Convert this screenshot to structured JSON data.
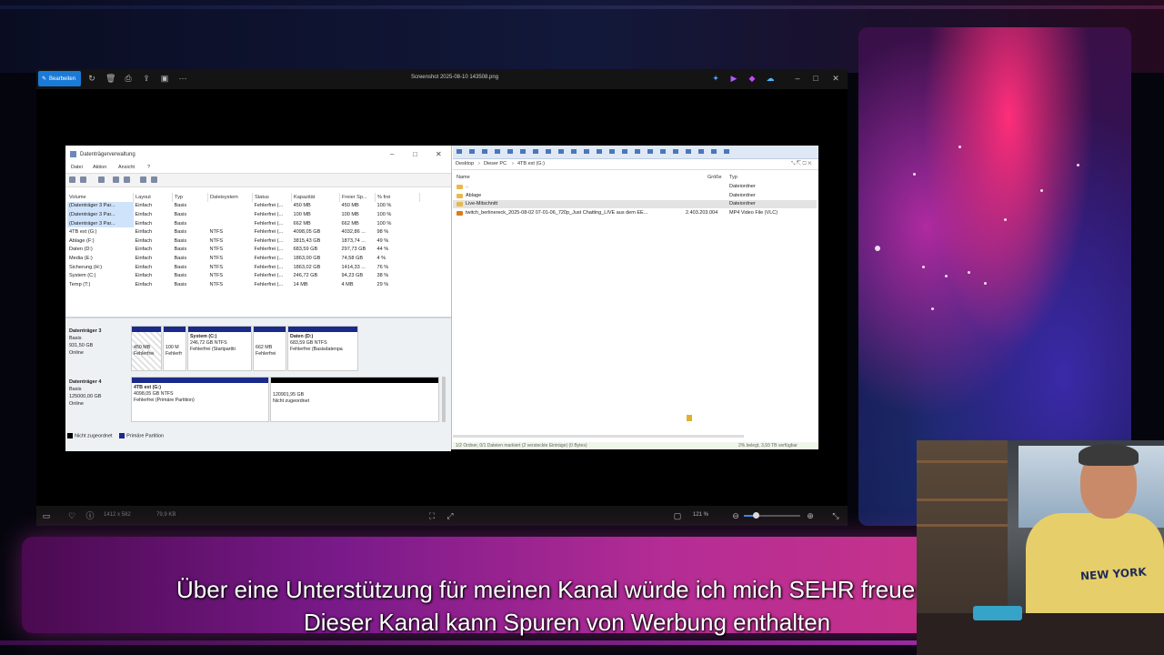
{
  "viewer": {
    "edit_label": "Bearbeiten",
    "title": "Screenshot 2025-08-10 143508.png",
    "zoom": "121 %",
    "info_dims": "1412 x 582",
    "info_size": "79,9 KB"
  },
  "disk_mgmt": {
    "title": "Datenträgerverwaltung",
    "menu": [
      "Datei",
      "Aktion",
      "Ansicht",
      "?"
    ],
    "columns": [
      "Volume",
      "Layout",
      "Typ",
      "Dateisystem",
      "Status",
      "Kapazität",
      "Freier Sp...",
      "% frei"
    ],
    "rows": [
      [
        "(Datenträger 3 Par...",
        "Einfach",
        "Basis",
        "",
        "Fehlerfrei (...",
        "450 MB",
        "450 MB",
        "100 %"
      ],
      [
        "(Datenträger 3 Par...",
        "Einfach",
        "Basis",
        "",
        "Fehlerfrei (...",
        "100 MB",
        "100 MB",
        "100 %"
      ],
      [
        "(Datenträger 3 Par...",
        "Einfach",
        "Basis",
        "",
        "Fehlerfrei (...",
        "662 MB",
        "662 MB",
        "100 %"
      ],
      [
        "4TB ext (G:)",
        "Einfach",
        "Basis",
        "NTFS",
        "Fehlerfrei (...",
        "4098,05 GB",
        "4032,86 ...",
        "98 %"
      ],
      [
        "Ablage (F:)",
        "Einfach",
        "Basis",
        "NTFS",
        "Fehlerfrei (...",
        "3815,43 GB",
        "1873,74 ...",
        "49 %"
      ],
      [
        "Daten (D:)",
        "Einfach",
        "Basis",
        "NTFS",
        "Fehlerfrei (...",
        "683,59 GB",
        "297,73 GB",
        "44 %"
      ],
      [
        "Media (E:)",
        "Einfach",
        "Basis",
        "NTFS",
        "Fehlerfrei (...",
        "1863,00 GB",
        "74,58 GB",
        "4 %"
      ],
      [
        "Sicherung (H:)",
        "Einfach",
        "Basis",
        "NTFS",
        "Fehlerfrei (...",
        "1863,02 GB",
        "1414,33 ...",
        "76 %"
      ],
      [
        "System (C:)",
        "Einfach",
        "Basis",
        "NTFS",
        "Fehlerfrei (...",
        "246,72 GB",
        "94,23 GB",
        "38 %"
      ],
      [
        "Temp (T:)",
        "Einfach",
        "Basis",
        "NTFS",
        "Fehlerfrei (...",
        "14 MB",
        "4 MB",
        "29 %"
      ]
    ],
    "disk3": {
      "name": "Datenträger 3",
      "type": "Basis",
      "size": "931,50 GB",
      "state": "Online",
      "p1_size": "450 MB",
      "p1_status": "Fehlerfrei",
      "p2_size": "100 M",
      "p2_status": "Fehlerfr",
      "p3_name": "System (C:)",
      "p3_size": "246,72 GB NTFS",
      "p3_status": "Fehlerfrei (Startpartiti",
      "p4_size": "662 MB",
      "p4_status": "Fehlerfrei",
      "p5_name": "Daten (D:)",
      "p5_size": "683,59 GB NTFS",
      "p5_status": "Fehlerfrei (Basisdatenpa"
    },
    "disk4": {
      "name": "Datenträger 4",
      "type": "Basis",
      "size": "125000,00 GB",
      "state": "Online",
      "p1_name": "4TB ext (G:)",
      "p1_size": "4098,05 GB NTFS",
      "p1_status": "Fehlerfrei (Primäre Partition)",
      "p2_size": "120901,95 GB",
      "p2_status": "Nicht zugeordnet"
    },
    "legend": [
      "Nicht zugeordnet",
      "Primäre Partition"
    ]
  },
  "explorer": {
    "address": [
      "Desktop",
      "Dieser PC",
      "4TB ext (G:)"
    ],
    "columns": [
      "Name",
      "Größe",
      "Typ"
    ],
    "rows": [
      {
        "name": "..",
        "size": "",
        "type": "Dateiordner"
      },
      {
        "name": "Ablage",
        "size": "",
        "type": "Dateiordner"
      },
      {
        "name": "Live-Mitschnitt",
        "size": "",
        "type": "Dateiordner"
      },
      {
        "name": "twitch_berlinereck_2025-08-02 07-01-06_720p_Just Chatting_LIVE aus dem EE...",
        "size": "2.403.203.004",
        "type": "MP4 Video File (VLC)"
      }
    ],
    "status_left": "1/2 Ordner, 0/1 Dateien markiert (2 versteckte Einträge) (0 Bytes)",
    "status_right": "2% belegt, 3,93 TB verfügbar"
  },
  "subtitles": {
    "line1": "Über eine Unterstützung für meinen Kanal würde ich mich SEHR freuen",
    "line2": "Dieser Kanal kann Spuren von Werbung enthalten"
  },
  "webcam": {
    "shirt_text": "NEW YORK"
  },
  "colors": {
    "accent": "#1a7ad8",
    "primary_partition": "#1a2a8a",
    "unallocated": "#000000",
    "banner": "#b42c95"
  }
}
